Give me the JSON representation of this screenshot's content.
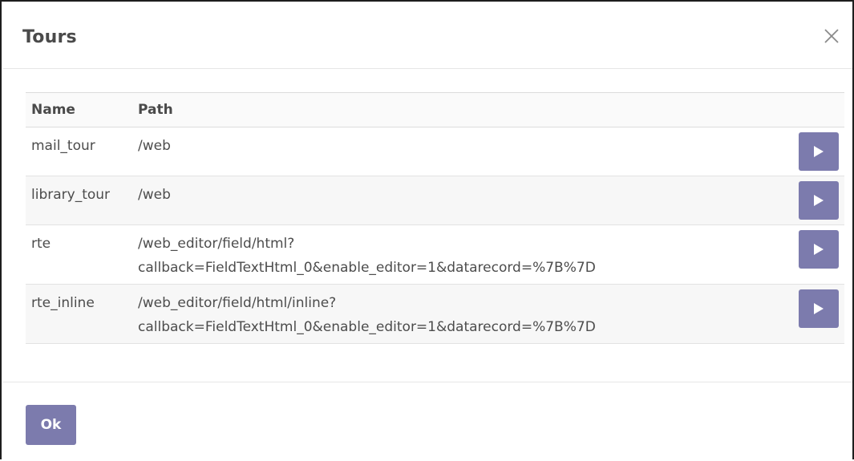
{
  "dialog": {
    "title": "Tours",
    "close_icon": "close-icon"
  },
  "table": {
    "headers": {
      "name": "Name",
      "path": "Path"
    },
    "rows": [
      {
        "name": "mail_tour",
        "path_line1": "/web",
        "path_line2": ""
      },
      {
        "name": "library_tour",
        "path_line1": "/web",
        "path_line2": ""
      },
      {
        "name": "rte",
        "path_line1": "/web_editor/field/html?",
        "path_line2": "callback=FieldTextHtml_0&enable_editor=1&datarecord=%7B%7D"
      },
      {
        "name": "rte_inline",
        "path_line1": "/web_editor/field/html/inline?",
        "path_line2": "callback=FieldTextHtml_0&enable_editor=1&datarecord=%7B%7D"
      }
    ],
    "row_action_icon": "play-icon"
  },
  "footer": {
    "ok_label": "Ok"
  },
  "colors": {
    "accent": "#7c7bad",
    "text": "#4c4c4c"
  }
}
